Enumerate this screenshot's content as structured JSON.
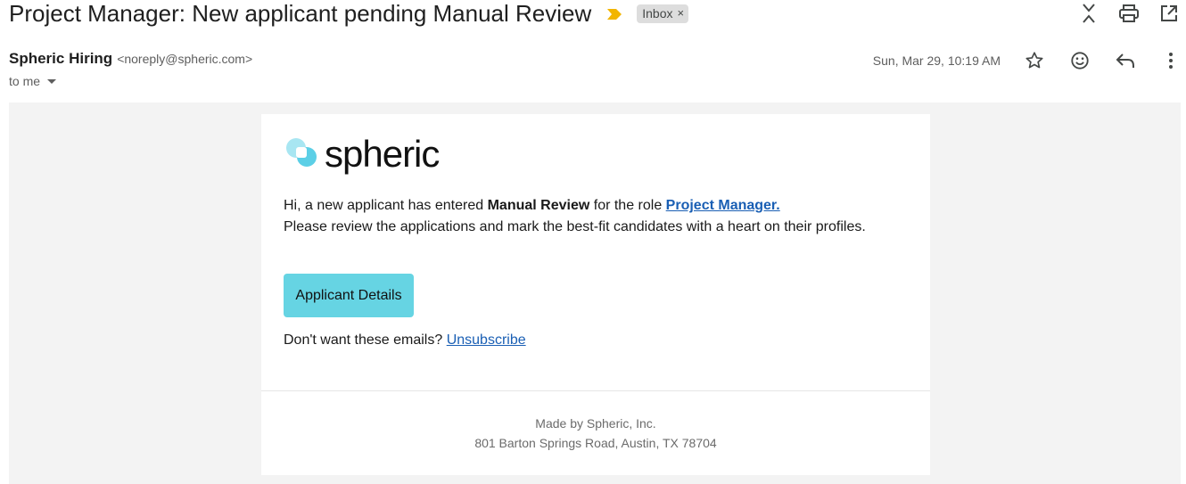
{
  "subject": "Project Manager: New applicant pending Manual Review",
  "label": {
    "name": "Inbox",
    "remove": "×"
  },
  "icons": {
    "importance": "importance-marker-icon",
    "collapse": "collapse-all-icon",
    "print": "print-icon",
    "new_window": "open-in-new-window-icon",
    "star": "star-icon",
    "emoji": "emoji-react-icon",
    "reply": "reply-icon",
    "more": "more-vert-icon",
    "logo": "spheric-logo-icon"
  },
  "sender": {
    "name": "Spheric Hiring",
    "email": "<noreply@spheric.com>"
  },
  "recipient": {
    "label": "to me"
  },
  "date": "Sun, Mar 29, 10:19 AM",
  "email": {
    "logo_text": "spheric",
    "line1_prefix": "Hi, a new applicant has entered ",
    "line1_bold": "Manual Review",
    "line1_mid": " for the role ",
    "line1_link": "Project Manager.",
    "line2": "Please review the applications and mark the best-fit candidates with a heart on their profiles.",
    "cta_label": "Applicant Details",
    "unsubscribe_prefix": "Don't want these emails? ",
    "unsubscribe_link": "Unsubscribe",
    "footer_company": "Made by Spheric, Inc.",
    "footer_address": "801 Barton Springs Road, Austin, TX 78704"
  },
  "colors": {
    "importance": "#f2b500",
    "cta": "#66d4e3",
    "link": "#1a5fb4",
    "logo_cyan": "#5ccfe6",
    "logo_cyan_light": "#a8e6f2",
    "canvas": "#f3f3f3"
  }
}
